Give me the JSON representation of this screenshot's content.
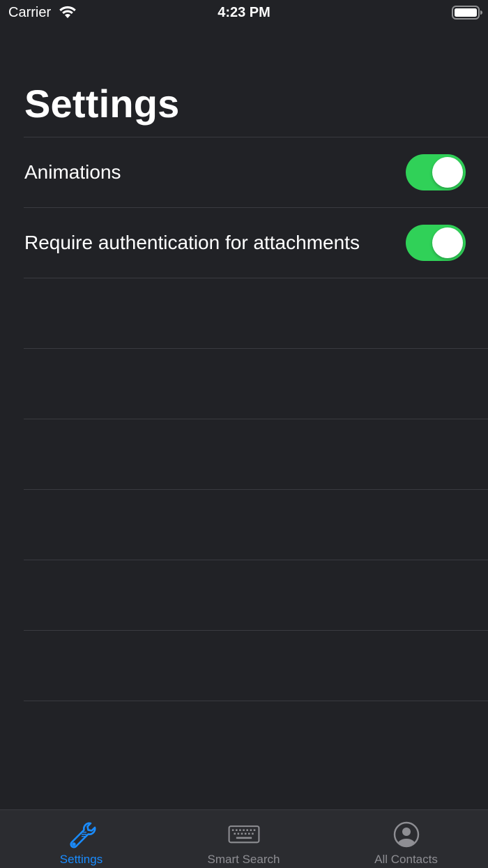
{
  "status_bar": {
    "carrier": "Carrier",
    "time": "4:23 PM"
  },
  "page": {
    "title": "Settings"
  },
  "settings": {
    "rows": [
      {
        "label": "Animations",
        "toggle_on": true
      },
      {
        "label": "Require authentication for attachments",
        "toggle_on": true
      }
    ]
  },
  "tab_bar": {
    "tabs": [
      {
        "label": "Settings",
        "icon": "wrench-icon",
        "selected": true
      },
      {
        "label": "Smart Search",
        "icon": "keyboard-icon",
        "selected": false
      },
      {
        "label": "All Contacts",
        "icon": "person-circle-icon",
        "selected": false
      }
    ]
  },
  "colors": {
    "background": "#212226",
    "tab_bar_background": "#2b2c30",
    "separator": "#3a3b40",
    "toggle_on": "#30d158",
    "tab_selected": "#1a8cff",
    "tab_unselected": "#8e8e93"
  }
}
